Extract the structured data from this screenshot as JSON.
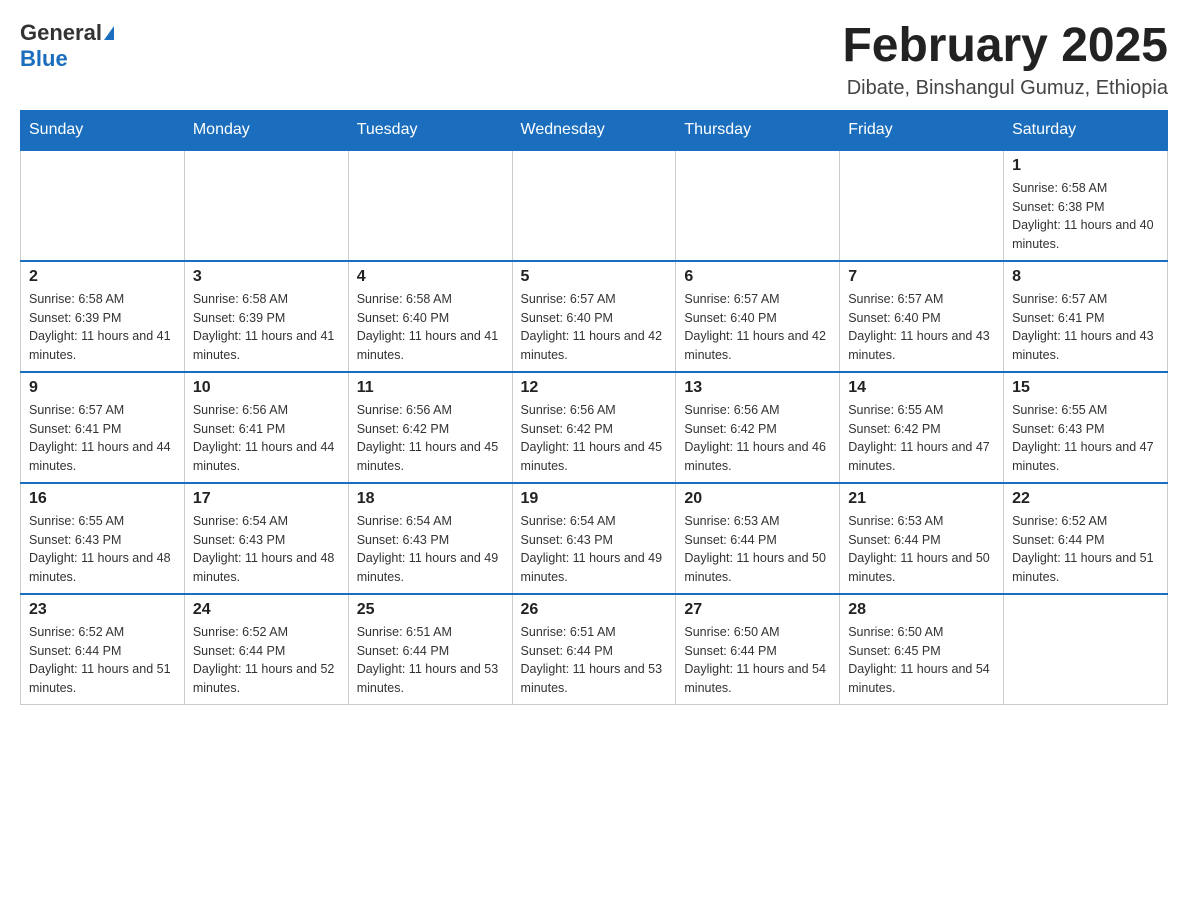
{
  "logo": {
    "general": "General",
    "blue": "Blue"
  },
  "header": {
    "title": "February 2025",
    "location": "Dibate, Binshangul Gumuz, Ethiopia"
  },
  "weekdays": [
    "Sunday",
    "Monday",
    "Tuesday",
    "Wednesday",
    "Thursday",
    "Friday",
    "Saturday"
  ],
  "weeks": [
    [
      {
        "day": "",
        "info": ""
      },
      {
        "day": "",
        "info": ""
      },
      {
        "day": "",
        "info": ""
      },
      {
        "day": "",
        "info": ""
      },
      {
        "day": "",
        "info": ""
      },
      {
        "day": "",
        "info": ""
      },
      {
        "day": "1",
        "info": "Sunrise: 6:58 AM\nSunset: 6:38 PM\nDaylight: 11 hours and 40 minutes."
      }
    ],
    [
      {
        "day": "2",
        "info": "Sunrise: 6:58 AM\nSunset: 6:39 PM\nDaylight: 11 hours and 41 minutes."
      },
      {
        "day": "3",
        "info": "Sunrise: 6:58 AM\nSunset: 6:39 PM\nDaylight: 11 hours and 41 minutes."
      },
      {
        "day": "4",
        "info": "Sunrise: 6:58 AM\nSunset: 6:40 PM\nDaylight: 11 hours and 41 minutes."
      },
      {
        "day": "5",
        "info": "Sunrise: 6:57 AM\nSunset: 6:40 PM\nDaylight: 11 hours and 42 minutes."
      },
      {
        "day": "6",
        "info": "Sunrise: 6:57 AM\nSunset: 6:40 PM\nDaylight: 11 hours and 42 minutes."
      },
      {
        "day": "7",
        "info": "Sunrise: 6:57 AM\nSunset: 6:40 PM\nDaylight: 11 hours and 43 minutes."
      },
      {
        "day": "8",
        "info": "Sunrise: 6:57 AM\nSunset: 6:41 PM\nDaylight: 11 hours and 43 minutes."
      }
    ],
    [
      {
        "day": "9",
        "info": "Sunrise: 6:57 AM\nSunset: 6:41 PM\nDaylight: 11 hours and 44 minutes."
      },
      {
        "day": "10",
        "info": "Sunrise: 6:56 AM\nSunset: 6:41 PM\nDaylight: 11 hours and 44 minutes."
      },
      {
        "day": "11",
        "info": "Sunrise: 6:56 AM\nSunset: 6:42 PM\nDaylight: 11 hours and 45 minutes."
      },
      {
        "day": "12",
        "info": "Sunrise: 6:56 AM\nSunset: 6:42 PM\nDaylight: 11 hours and 45 minutes."
      },
      {
        "day": "13",
        "info": "Sunrise: 6:56 AM\nSunset: 6:42 PM\nDaylight: 11 hours and 46 minutes."
      },
      {
        "day": "14",
        "info": "Sunrise: 6:55 AM\nSunset: 6:42 PM\nDaylight: 11 hours and 47 minutes."
      },
      {
        "day": "15",
        "info": "Sunrise: 6:55 AM\nSunset: 6:43 PM\nDaylight: 11 hours and 47 minutes."
      }
    ],
    [
      {
        "day": "16",
        "info": "Sunrise: 6:55 AM\nSunset: 6:43 PM\nDaylight: 11 hours and 48 minutes."
      },
      {
        "day": "17",
        "info": "Sunrise: 6:54 AM\nSunset: 6:43 PM\nDaylight: 11 hours and 48 minutes."
      },
      {
        "day": "18",
        "info": "Sunrise: 6:54 AM\nSunset: 6:43 PM\nDaylight: 11 hours and 49 minutes."
      },
      {
        "day": "19",
        "info": "Sunrise: 6:54 AM\nSunset: 6:43 PM\nDaylight: 11 hours and 49 minutes."
      },
      {
        "day": "20",
        "info": "Sunrise: 6:53 AM\nSunset: 6:44 PM\nDaylight: 11 hours and 50 minutes."
      },
      {
        "day": "21",
        "info": "Sunrise: 6:53 AM\nSunset: 6:44 PM\nDaylight: 11 hours and 50 minutes."
      },
      {
        "day": "22",
        "info": "Sunrise: 6:52 AM\nSunset: 6:44 PM\nDaylight: 11 hours and 51 minutes."
      }
    ],
    [
      {
        "day": "23",
        "info": "Sunrise: 6:52 AM\nSunset: 6:44 PM\nDaylight: 11 hours and 51 minutes."
      },
      {
        "day": "24",
        "info": "Sunrise: 6:52 AM\nSunset: 6:44 PM\nDaylight: 11 hours and 52 minutes."
      },
      {
        "day": "25",
        "info": "Sunrise: 6:51 AM\nSunset: 6:44 PM\nDaylight: 11 hours and 53 minutes."
      },
      {
        "day": "26",
        "info": "Sunrise: 6:51 AM\nSunset: 6:44 PM\nDaylight: 11 hours and 53 minutes."
      },
      {
        "day": "27",
        "info": "Sunrise: 6:50 AM\nSunset: 6:44 PM\nDaylight: 11 hours and 54 minutes."
      },
      {
        "day": "28",
        "info": "Sunrise: 6:50 AM\nSunset: 6:45 PM\nDaylight: 11 hours and 54 minutes."
      },
      {
        "day": "",
        "info": ""
      }
    ]
  ]
}
